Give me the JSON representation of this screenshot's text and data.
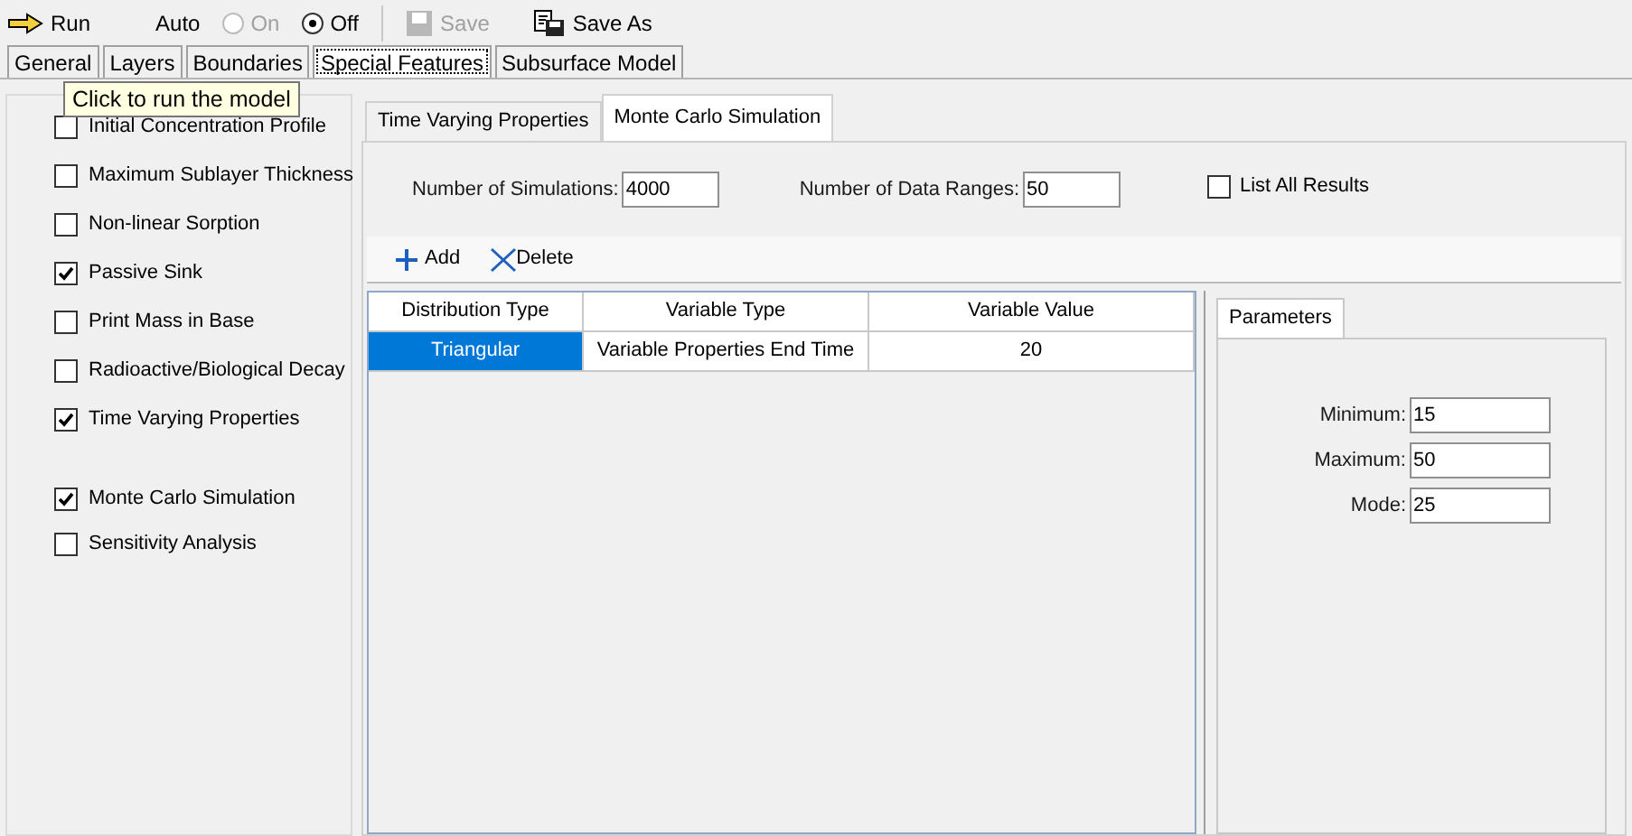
{
  "toolbar": {
    "run": "Run",
    "auto_label": "Auto",
    "modes": [
      {
        "label": "On",
        "selected": false,
        "disabled": true
      },
      {
        "label": "Off",
        "selected": true,
        "disabled": false
      }
    ],
    "save": {
      "label": "Save",
      "disabled": true
    },
    "save_as": {
      "label": "Save As",
      "disabled": false
    }
  },
  "tooltip": "Click to run the model",
  "tabs": [
    {
      "label": "General",
      "selected": false
    },
    {
      "label": "Layers",
      "selected": false
    },
    {
      "label": "Boundaries",
      "selected": false
    },
    {
      "label": "Special Features",
      "selected": true
    },
    {
      "label": "Subsurface Model",
      "selected": false
    }
  ],
  "feature_groups": [
    {
      "items": [
        {
          "label": "Initial Concentration Profile",
          "checked": false
        },
        {
          "label": "Maximum Sublayer Thickness",
          "checked": false
        },
        {
          "label": "Non-linear Sorption",
          "checked": false
        },
        {
          "label": "Passive Sink",
          "checked": true
        },
        {
          "label": "Print Mass in Base",
          "checked": false
        },
        {
          "label": "Radioactive/Biological Decay",
          "checked": false
        },
        {
          "label": "Time Varying Properties",
          "checked": true
        }
      ]
    },
    {
      "items": [
        {
          "label": "Monte Carlo Simulation",
          "checked": true
        },
        {
          "label": "Sensitivity Analysis",
          "checked": false
        }
      ]
    }
  ],
  "sub_tabs": [
    {
      "label": "Time Varying Properties",
      "selected": false
    },
    {
      "label": "Monte Carlo Simulation",
      "selected": true
    }
  ],
  "simulations": {
    "label": "Number of Simulations:",
    "value": "4000"
  },
  "data_ranges": {
    "label": "Number of Data Ranges:",
    "value": "50"
  },
  "list_all": {
    "label": "List All Results",
    "checked": false
  },
  "grid_toolbar": {
    "add": "Add",
    "delete": "Delete"
  },
  "table": {
    "columns": [
      "Distribution Type",
      "Variable Type",
      "Variable Value"
    ],
    "rows": [
      {
        "cells": [
          "Triangular",
          "Variable Properties End Time",
          "20"
        ],
        "selected": true
      }
    ]
  },
  "parameters": {
    "tab": "Parameters",
    "fields": [
      {
        "label": "Minimum:",
        "value": "15"
      },
      {
        "label": "Maximum:",
        "value": "50"
      },
      {
        "label": "Mode:",
        "value": "25"
      }
    ]
  }
}
